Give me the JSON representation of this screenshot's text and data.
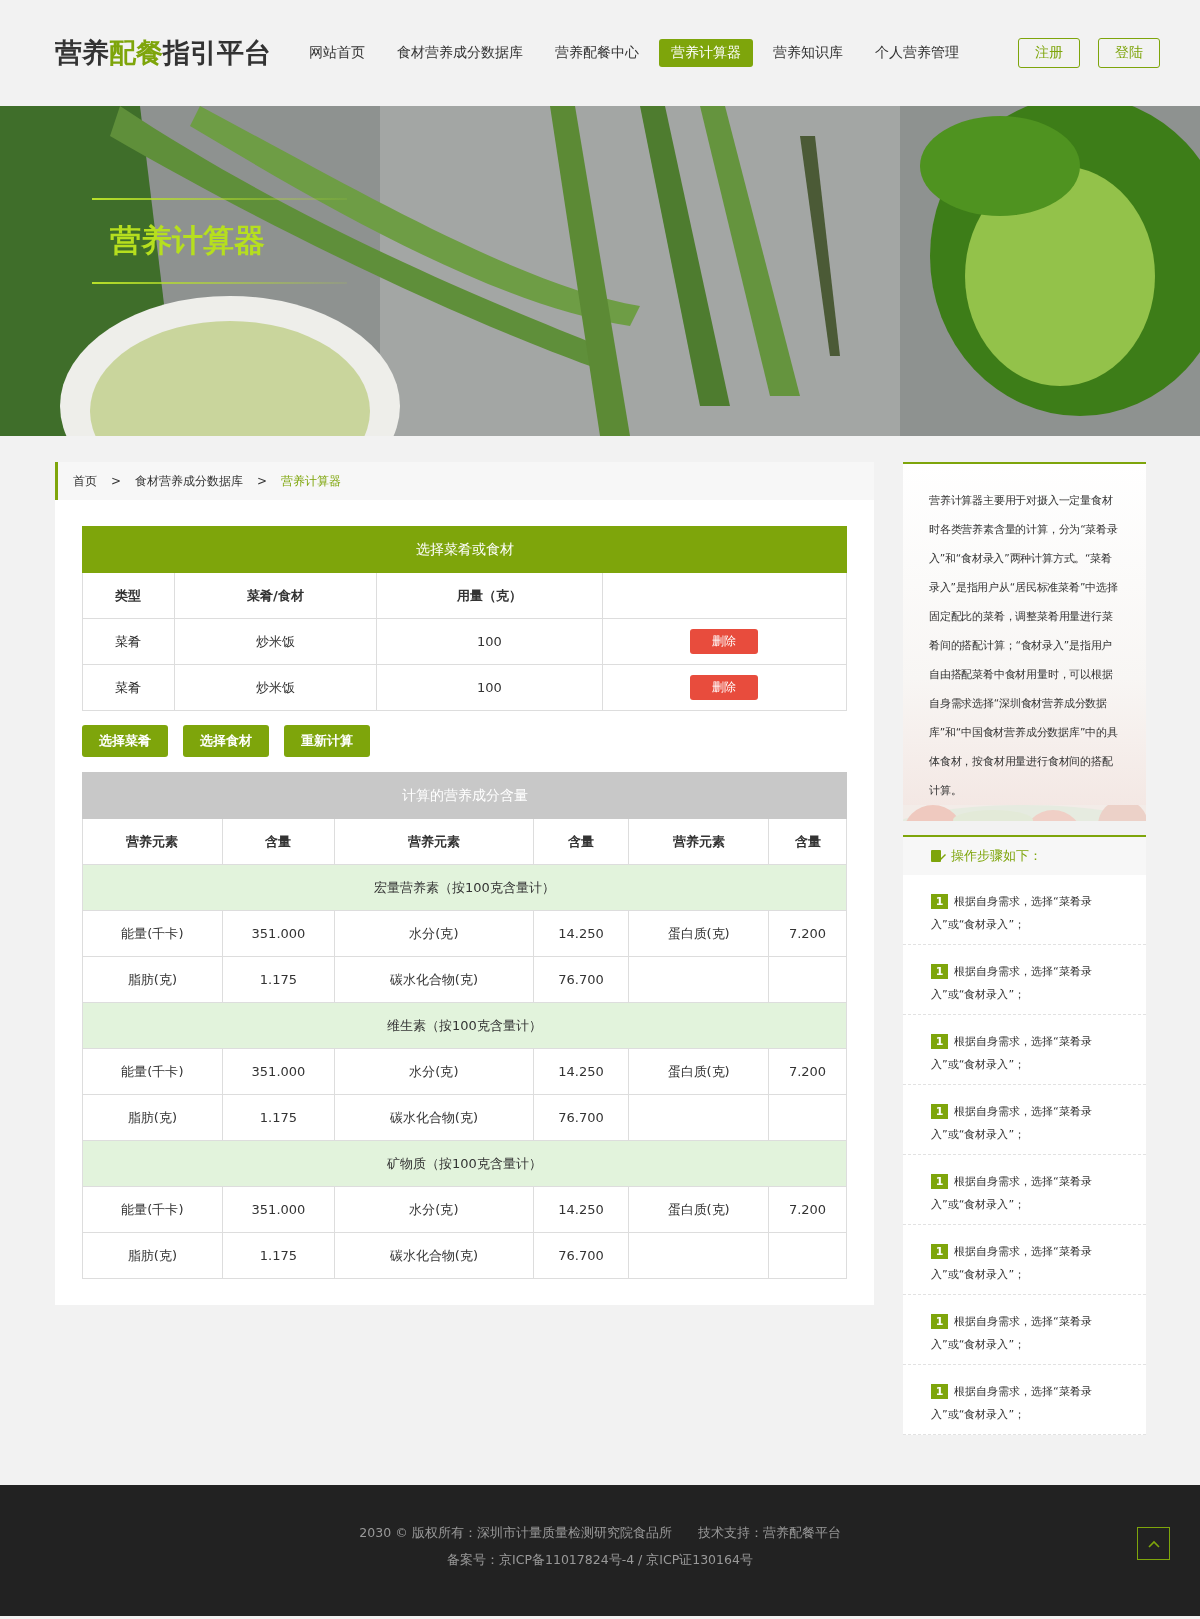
{
  "header": {
    "logo": [
      {
        "text": "营养",
        "highlight": false
      },
      {
        "text": "配餐",
        "highlight": true
      },
      {
        "text": "指引平台",
        "highlight": false
      }
    ],
    "nav": [
      {
        "label": "网站首页",
        "selected": false
      },
      {
        "label": "食材营养成分数据库",
        "selected": false
      },
      {
        "label": "营养配餐中心",
        "selected": false
      },
      {
        "label": "营养计算器",
        "selected": true
      },
      {
        "label": "营养知识库",
        "selected": false
      },
      {
        "label": "个人营养管理",
        "selected": false
      }
    ],
    "buttons": [
      "注册",
      "登陆"
    ]
  },
  "hero": {
    "title": "营养计算器",
    "kind": "picture"
  },
  "breadcrumb": [
    {
      "label": "首页",
      "selected": false
    },
    {
      "label": "食材营养成分数据库",
      "selected": false
    },
    {
      "label": "营养计算器",
      "selected": true
    }
  ],
  "breadcrumb_separator": ">",
  "selection_table": {
    "title": "选择菜肴或食材",
    "columns": [
      "类型",
      "菜肴/食材",
      "用量（克）"
    ],
    "rows": [
      {
        "type": "菜肴",
        "name": "炒米饭",
        "amount": "100",
        "action": "删除"
      },
      {
        "type": "菜肴",
        "name": "炒米饭",
        "amount": "100",
        "action": "删除"
      }
    ]
  },
  "actions": [
    "选择菜肴",
    "选择食材",
    "重新计算"
  ],
  "nutrition_table": {
    "title": "计算的营养成分含量",
    "columns": [
      "营养元素",
      "含量",
      "营养元素",
      "含量",
      "营养元素",
      "含量"
    ],
    "sections": [
      {
        "title": "宏量营养素（按100克含量计）",
        "rows": [
          [
            {
              "element": "能量(千卡)",
              "value": "351.000"
            },
            {
              "element": "水分(克)",
              "value": "14.250"
            },
            {
              "element": "蛋白质(克)",
              "value": "7.200"
            }
          ],
          [
            {
              "element": "脂肪(克)",
              "value": "1.175"
            },
            {
              "element": "碳水化合物(克)",
              "value": "76.700"
            }
          ]
        ]
      },
      {
        "title": "维生素（按100克含量计）",
        "rows": [
          [
            {
              "element": "能量(千卡)",
              "value": "351.000"
            },
            {
              "element": "水分(克)",
              "value": "14.250"
            },
            {
              "element": "蛋白质(克)",
              "value": "7.200"
            }
          ],
          [
            {
              "element": "脂肪(克)",
              "value": "1.175"
            },
            {
              "element": "碳水化合物(克)",
              "value": "76.700"
            }
          ]
        ]
      },
      {
        "title": "矿物质（按100克含量计）",
        "rows": [
          [
            {
              "element": "能量(千卡)",
              "value": "351.000"
            },
            {
              "element": "水分(克)",
              "value": "14.250"
            },
            {
              "element": "蛋白质(克)",
              "value": "7.200"
            }
          ],
          [
            {
              "element": "脂肪(克)",
              "value": "1.175"
            },
            {
              "element": "碳水化合物(克)",
              "value": "76.700"
            }
          ]
        ]
      }
    ]
  },
  "sidebar": {
    "intro": "营养计算器主要用于对摄入一定量食材时各类营养素含量的计算，分为“菜肴录入”和“食材录入”两种计算方式。“菜肴录入”是指用户从“居民标准菜肴”中选择固定配比的菜肴，调整菜肴用量进行菜肴间的搭配计算；“食材录入”是指用户自由搭配菜肴中食材用量时，可以根据自身需求选择“深圳食材营养成分数据库”和“中国食材营养成分数据库”中的具体食材，按食材用量进行食材间的搭配计算。",
    "steps_title": "操作步骤如下：",
    "steps": [
      {
        "number": "1",
        "text": "根据自身需求，选择“菜肴录入”或“食材录入”；"
      },
      {
        "number": "1",
        "text": "根据自身需求，选择“菜肴录入”或“食材录入”；"
      },
      {
        "number": "1",
        "text": "根据自身需求，选择“菜肴录入”或“食材录入”；"
      },
      {
        "number": "1",
        "text": "根据自身需求，选择“菜肴录入”或“食材录入”；"
      },
      {
        "number": "1",
        "text": "根据自身需求，选择“菜肴录入”或“食材录入”；"
      },
      {
        "number": "1",
        "text": "根据自身需求，选择“菜肴录入”或“食材录入”；"
      },
      {
        "number": "1",
        "text": "根据自身需求，选择“菜肴录入”或“食材录入”；"
      },
      {
        "number": "1",
        "text": "根据自身需求，选择“菜肴录入”或“食材录入”；"
      }
    ]
  },
  "footer": {
    "copyright": "2030 © 版权所有：深圳市计量质量检测研究院食品所",
    "support": "技术支持：营养配餐平台",
    "icp": "备案号：京ICP备11017824号-4 / 京ICP证130164号"
  }
}
